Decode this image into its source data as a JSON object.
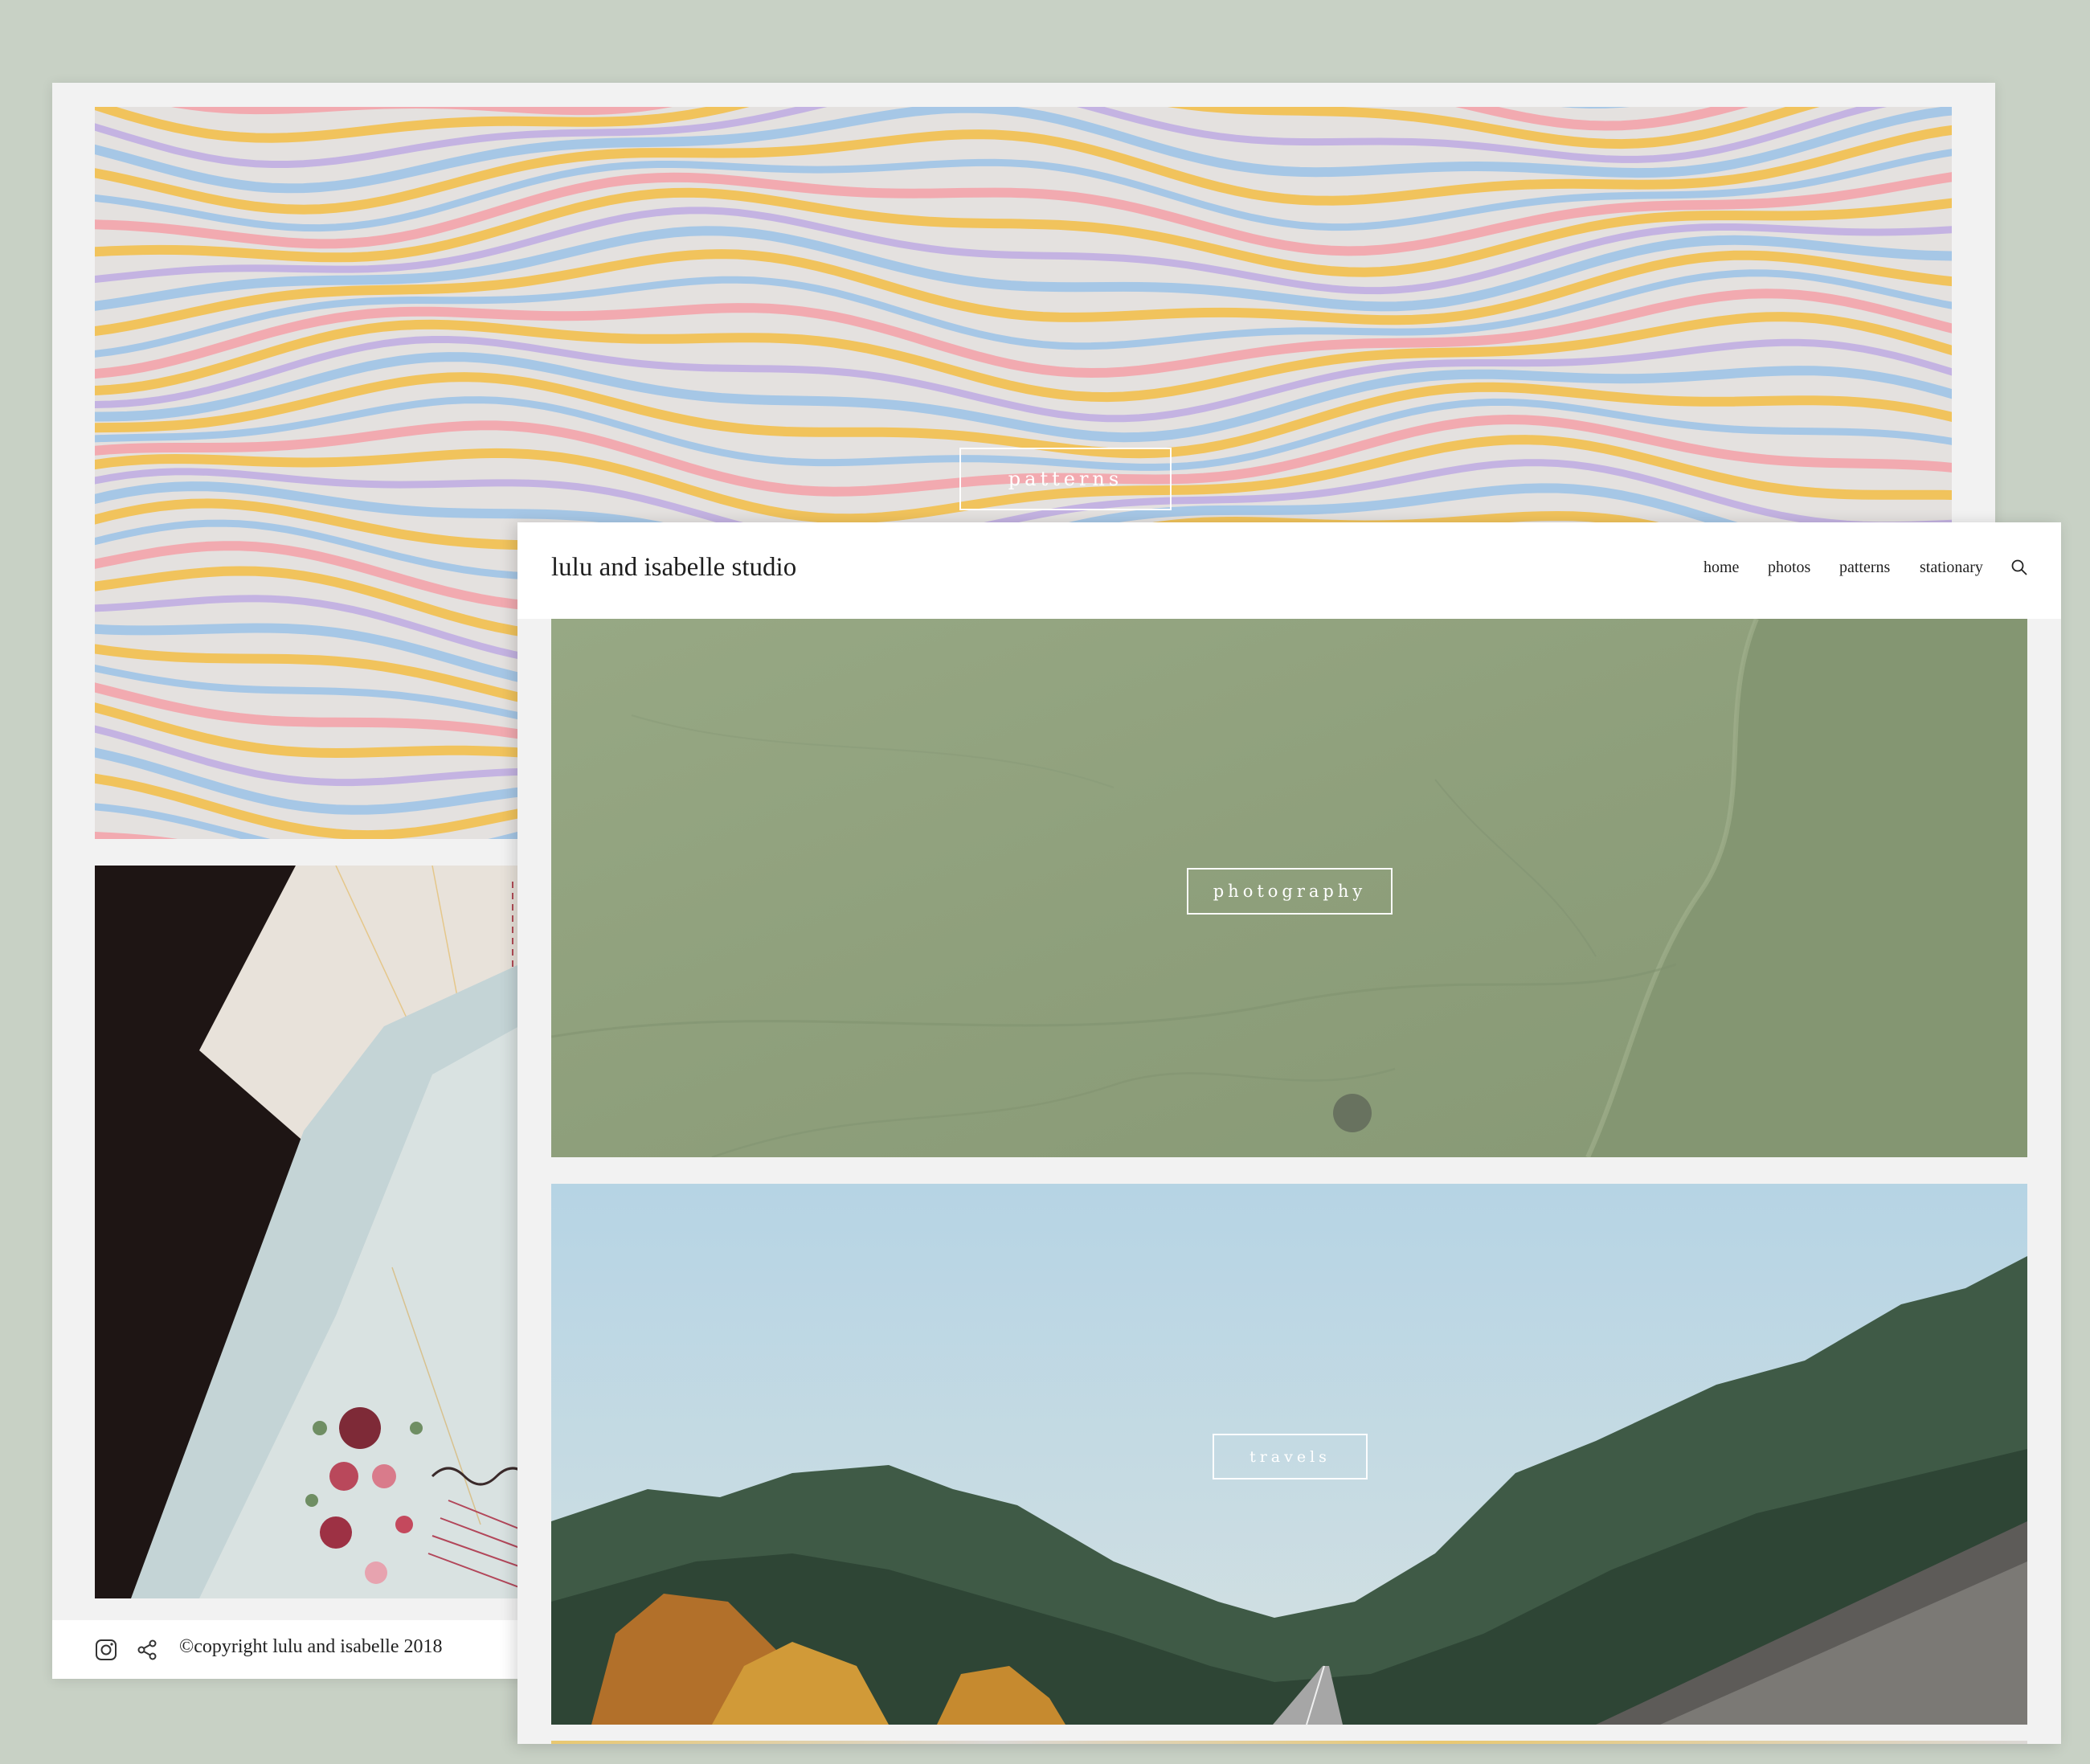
{
  "back_window": {
    "hero": {
      "button_label": "patterns",
      "image": "wavy-stripes-pattern"
    },
    "tile": {
      "image": "wedding-stationery-invitations"
    },
    "footer": {
      "icons": [
        "instagram-icon",
        "share-icon"
      ],
      "copyright": "©copyright lulu and isabelle 2018"
    }
  },
  "front_window": {
    "header": {
      "site_title": "lulu and isabelle studio",
      "nav": {
        "home": "home",
        "photos": "photos",
        "patterns": "patterns",
        "stationary": "stationary"
      },
      "search_icon": "search-icon"
    },
    "sections": {
      "photography": {
        "button_label": "photography",
        "image": "green-textured-paper"
      },
      "travels": {
        "button_label": "travels",
        "image": "misty-forest-road"
      }
    }
  },
  "colors": {
    "page_background": "#c8d1c5",
    "panel_background": "#f2f2f2",
    "stripe_yellow": "#f1c35c",
    "stripe_blue": "#a6c7e6",
    "stripe_pink": "#f2aab0",
    "stripe_lavender": "#c4b3e2",
    "moss_green": "#8fa27c",
    "sky_blue": "#b7d3e0"
  }
}
